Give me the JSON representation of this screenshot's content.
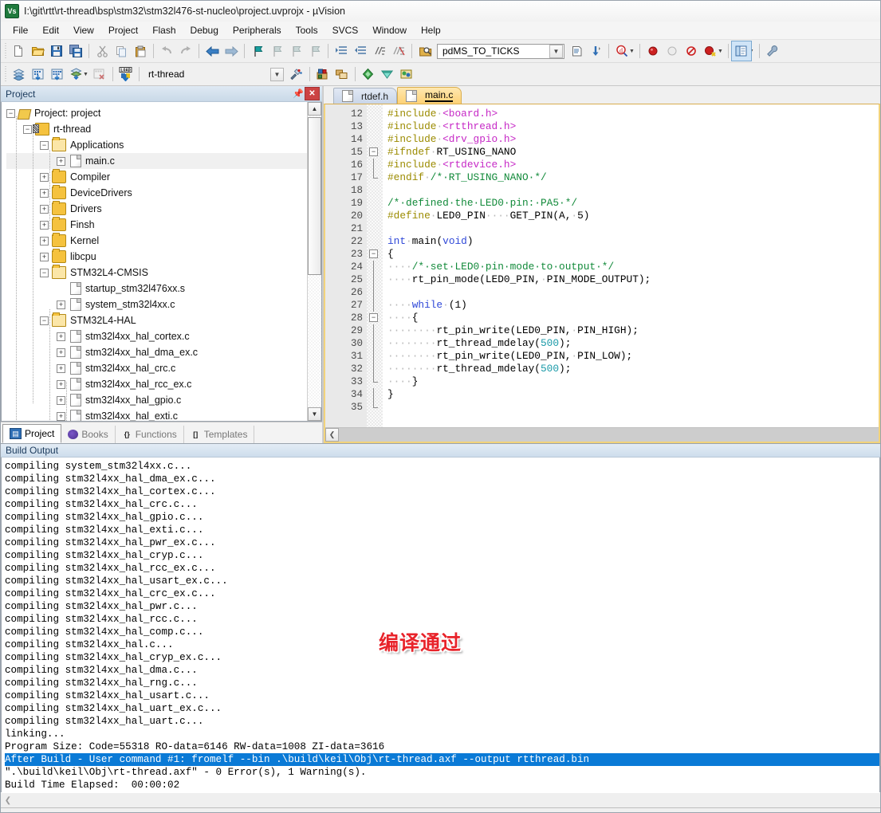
{
  "window": {
    "title": "I:\\git\\rtt\\rt-thread\\bsp\\stm32\\stm32l476-st-nucleo\\project.uvprojx - µVision",
    "app_badge": "Vs"
  },
  "menubar": {
    "items": [
      "File",
      "Edit",
      "View",
      "Project",
      "Flash",
      "Debug",
      "Peripherals",
      "Tools",
      "SVCS",
      "Window",
      "Help"
    ]
  },
  "toolbar1": {
    "groups": [
      [
        "new-file-icon",
        "open-file-icon",
        "save-icon",
        "save-all-icon"
      ],
      [
        "cut-icon",
        "copy-icon",
        "paste-icon"
      ],
      [
        "undo-icon",
        "redo-icon"
      ],
      [
        "navigate-back-icon",
        "navigate-forward-icon"
      ],
      [
        "bookmark-toggle-icon",
        "bookmark-prev-icon",
        "bookmark-next-icon",
        "bookmark-clear-icon"
      ],
      [
        "indent-icon",
        "outdent-icon",
        "comment-icon",
        "uncomment-icon"
      ]
    ],
    "find_in_files_icon": "find-in-files-icon",
    "find_value": "pdMS_TO_TICKS",
    "bookmark_list_icon": "text-list-icon",
    "goto_icon": "goto-icon",
    "debug_query_icon": "debug-query-icon",
    "breakpoint_icon": "insert-breakpoint-icon",
    "breakpoint_disable_icon": "disable-breakpoint-icon",
    "breakpoint_kill_icon": "kill-all-breakpoints-icon",
    "breakpoint_enable_icon": "enable-breakpoint-icon",
    "window_layout_icon": "window-layout-icon",
    "configure_icon": "configure-target-icon"
  },
  "toolbar2": {
    "translate_icon": "translate-icon",
    "build_icon": "build-icon",
    "rebuild_icon": "rebuild-all-icon",
    "batch_build_icon": "batch-build-icon",
    "stop_build_icon": "stop-build-icon",
    "download_icon": "load-download-icon",
    "target_value": "rt-thread",
    "target_options_icon": "target-options-icon",
    "manage_project_icon": "manage-project-items-icon",
    "multi_project_icon": "multi-project-icon",
    "pack_installer_icon": "pack-installer-icon",
    "manage_runtime_icon": "manage-runtime-environment-icon",
    "select_software_icon": "select-software-packs-icon"
  },
  "project_panel": {
    "caption": "Project",
    "pin_icon": "pin-icon",
    "close_icon": "close-icon",
    "tree": [
      {
        "indent": 0,
        "expander": "minus",
        "icon": "project-icon",
        "label": "Project: project",
        "selected": false
      },
      {
        "indent": 1,
        "expander": "minus",
        "icon": "target-icon",
        "label": "rt-thread",
        "selected": false
      },
      {
        "indent": 2,
        "expander": "minus",
        "icon": "folder-open-icon",
        "label": "Applications",
        "selected": false
      },
      {
        "indent": 3,
        "expander": "plus",
        "icon": "file-icon",
        "label": "main.c",
        "selected": true
      },
      {
        "indent": 2,
        "expander": "plus",
        "icon": "folder-icon",
        "label": "Compiler",
        "selected": false
      },
      {
        "indent": 2,
        "expander": "plus",
        "icon": "folder-icon",
        "label": "DeviceDrivers",
        "selected": false
      },
      {
        "indent": 2,
        "expander": "plus",
        "icon": "folder-icon",
        "label": "Drivers",
        "selected": false
      },
      {
        "indent": 2,
        "expander": "plus",
        "icon": "folder-icon",
        "label": "Finsh",
        "selected": false
      },
      {
        "indent": 2,
        "expander": "plus",
        "icon": "folder-icon",
        "label": "Kernel",
        "selected": false
      },
      {
        "indent": 2,
        "expander": "plus",
        "icon": "folder-icon",
        "label": "libcpu",
        "selected": false
      },
      {
        "indent": 2,
        "expander": "minus",
        "icon": "folder-open-icon",
        "label": "STM32L4-CMSIS",
        "selected": false
      },
      {
        "indent": 3,
        "expander": "none",
        "icon": "file-icon",
        "label": "startup_stm32l476xx.s",
        "selected": false
      },
      {
        "indent": 3,
        "expander": "plus",
        "icon": "file-icon",
        "label": "system_stm32l4xx.c",
        "selected": false
      },
      {
        "indent": 2,
        "expander": "minus",
        "icon": "folder-open-icon",
        "label": "STM32L4-HAL",
        "selected": false
      },
      {
        "indent": 3,
        "expander": "plus",
        "icon": "file-icon",
        "label": "stm32l4xx_hal_cortex.c",
        "selected": false
      },
      {
        "indent": 3,
        "expander": "plus",
        "icon": "file-icon",
        "label": "stm32l4xx_hal_dma_ex.c",
        "selected": false
      },
      {
        "indent": 3,
        "expander": "plus",
        "icon": "file-icon",
        "label": "stm32l4xx_hal_crc.c",
        "selected": false
      },
      {
        "indent": 3,
        "expander": "plus",
        "icon": "file-icon",
        "label": "stm32l4xx_hal_rcc_ex.c",
        "selected": false
      },
      {
        "indent": 3,
        "expander": "plus",
        "icon": "file-icon",
        "label": "stm32l4xx_hal_gpio.c",
        "selected": false
      },
      {
        "indent": 3,
        "expander": "plus",
        "icon": "file-icon",
        "label": "stm32l4xx_hal_exti.c",
        "selected": false
      }
    ],
    "tabs": [
      {
        "label": "Project",
        "icon": "project-tab-icon",
        "active": true
      },
      {
        "label": "Books",
        "icon": "books-tab-icon",
        "active": false
      },
      {
        "label": "Functions",
        "icon": "functions-tab-icon",
        "active": false
      },
      {
        "label": "Templates",
        "icon": "templates-tab-icon",
        "active": false
      }
    ]
  },
  "editor": {
    "tabs": [
      {
        "label": "rtdef.h",
        "active": false,
        "icon": "file-icon"
      },
      {
        "label": "main.c",
        "active": true,
        "icon": "file-icon"
      }
    ],
    "first_line": 12,
    "lines": [
      {
        "n": 12,
        "fold": "none",
        "tokens": [
          {
            "t": "#include",
            "c": "pre"
          },
          {
            "t": "·",
            "c": "ws"
          },
          {
            "t": "<board.h>",
            "c": "inc"
          }
        ]
      },
      {
        "n": 13,
        "fold": "none",
        "tokens": [
          {
            "t": "#include",
            "c": "pre"
          },
          {
            "t": "·",
            "c": "ws"
          },
          {
            "t": "<rtthread.h>",
            "c": "inc"
          }
        ]
      },
      {
        "n": 14,
        "fold": "none",
        "tokens": [
          {
            "t": "#include",
            "c": "pre"
          },
          {
            "t": "·",
            "c": "ws"
          },
          {
            "t": "<drv_gpio.h>",
            "c": "inc"
          }
        ]
      },
      {
        "n": 15,
        "fold": "minus",
        "tokens": [
          {
            "t": "#ifndef",
            "c": "pre"
          },
          {
            "t": "·",
            "c": "ws"
          },
          {
            "t": "RT_USING_NANO",
            "c": "txt"
          }
        ]
      },
      {
        "n": 16,
        "fold": "bar",
        "tokens": [
          {
            "t": "#include",
            "c": "pre"
          },
          {
            "t": "·",
            "c": "ws"
          },
          {
            "t": "<rtdevice.h>",
            "c": "inc"
          }
        ]
      },
      {
        "n": 17,
        "fold": "barend",
        "tokens": [
          {
            "t": "#endif",
            "c": "pre"
          },
          {
            "t": "·",
            "c": "ws"
          },
          {
            "t": "/*·RT_USING_NANO·*/",
            "c": "cmt"
          }
        ]
      },
      {
        "n": 18,
        "fold": "none",
        "tokens": []
      },
      {
        "n": 19,
        "fold": "none",
        "tokens": [
          {
            "t": "/*·defined·the·LED0·pin:·PA5·*/",
            "c": "cmt"
          }
        ]
      },
      {
        "n": 20,
        "fold": "none",
        "tokens": [
          {
            "t": "#define",
            "c": "pre"
          },
          {
            "t": "·",
            "c": "ws"
          },
          {
            "t": "LED0_PIN",
            "c": "txt"
          },
          {
            "t": "····",
            "c": "ws"
          },
          {
            "t": "GET_PIN(A,",
            "c": "txt"
          },
          {
            "t": "·",
            "c": "ws"
          },
          {
            "t": "5)",
            "c": "txt"
          }
        ]
      },
      {
        "n": 21,
        "fold": "none",
        "tokens": []
      },
      {
        "n": 22,
        "fold": "none",
        "tokens": [
          {
            "t": "int",
            "c": "key"
          },
          {
            "t": "·",
            "c": "ws"
          },
          {
            "t": "main(",
            "c": "txt"
          },
          {
            "t": "void",
            "c": "key"
          },
          {
            "t": ")",
            "c": "txt"
          }
        ]
      },
      {
        "n": 23,
        "fold": "minus",
        "tokens": [
          {
            "t": "{",
            "c": "txt"
          }
        ]
      },
      {
        "n": 24,
        "fold": "bar",
        "tokens": [
          {
            "t": "····",
            "c": "ws"
          },
          {
            "t": "/*·set·LED0·pin·mode·to·output·*/",
            "c": "cmt"
          }
        ]
      },
      {
        "n": 25,
        "fold": "bar",
        "tokens": [
          {
            "t": "····",
            "c": "ws"
          },
          {
            "t": "rt_pin_mode(LED0_PIN,",
            "c": "txt"
          },
          {
            "t": "·",
            "c": "ws"
          },
          {
            "t": "PIN_MODE_OUTPUT);",
            "c": "txt"
          }
        ]
      },
      {
        "n": 26,
        "fold": "bar",
        "tokens": []
      },
      {
        "n": 27,
        "fold": "bar",
        "tokens": [
          {
            "t": "····",
            "c": "ws"
          },
          {
            "t": "while",
            "c": "key"
          },
          {
            "t": "·",
            "c": "ws"
          },
          {
            "t": "(1)",
            "c": "txt"
          }
        ]
      },
      {
        "n": 28,
        "fold": "minus2",
        "tokens": [
          {
            "t": "····",
            "c": "ws"
          },
          {
            "t": "{",
            "c": "txt"
          }
        ]
      },
      {
        "n": 29,
        "fold": "bar",
        "tokens": [
          {
            "t": "········",
            "c": "ws"
          },
          {
            "t": "rt_pin_write(LED0_PIN,",
            "c": "txt"
          },
          {
            "t": "·",
            "c": "ws"
          },
          {
            "t": "PIN_HIGH);",
            "c": "txt"
          }
        ]
      },
      {
        "n": 30,
        "fold": "bar",
        "tokens": [
          {
            "t": "········",
            "c": "ws"
          },
          {
            "t": "rt_thread_mdelay(",
            "c": "txt"
          },
          {
            "t": "500",
            "c": "num"
          },
          {
            "t": ");",
            "c": "txt"
          }
        ]
      },
      {
        "n": 31,
        "fold": "bar",
        "tokens": [
          {
            "t": "········",
            "c": "ws"
          },
          {
            "t": "rt_pin_write(LED0_PIN,",
            "c": "txt"
          },
          {
            "t": "·",
            "c": "ws"
          },
          {
            "t": "PIN_LOW);",
            "c": "txt"
          }
        ]
      },
      {
        "n": 32,
        "fold": "bar",
        "tokens": [
          {
            "t": "········",
            "c": "ws"
          },
          {
            "t": "rt_thread_mdelay(",
            "c": "txt"
          },
          {
            "t": "500",
            "c": "num"
          },
          {
            "t": ");",
            "c": "txt"
          }
        ]
      },
      {
        "n": 33,
        "fold": "barend",
        "tokens": [
          {
            "t": "····",
            "c": "ws"
          },
          {
            "t": "}",
            "c": "txt"
          }
        ]
      },
      {
        "n": 34,
        "fold": "bar",
        "tokens": [
          {
            "t": "}",
            "c": "txt"
          }
        ]
      },
      {
        "n": 35,
        "fold": "barend",
        "tokens": []
      }
    ]
  },
  "build_output": {
    "caption": "Build Output",
    "lines": [
      {
        "text": "compiling system_stm32l4xx.c...",
        "highlight": false
      },
      {
        "text": "compiling stm32l4xx_hal_dma_ex.c...",
        "highlight": false
      },
      {
        "text": "compiling stm32l4xx_hal_cortex.c...",
        "highlight": false
      },
      {
        "text": "compiling stm32l4xx_hal_crc.c...",
        "highlight": false
      },
      {
        "text": "compiling stm32l4xx_hal_gpio.c...",
        "highlight": false
      },
      {
        "text": "compiling stm32l4xx_hal_exti.c...",
        "highlight": false
      },
      {
        "text": "compiling stm32l4xx_hal_pwr_ex.c...",
        "highlight": false
      },
      {
        "text": "compiling stm32l4xx_hal_cryp.c...",
        "highlight": false
      },
      {
        "text": "compiling stm32l4xx_hal_rcc_ex.c...",
        "highlight": false
      },
      {
        "text": "compiling stm32l4xx_hal_usart_ex.c...",
        "highlight": false
      },
      {
        "text": "compiling stm32l4xx_hal_crc_ex.c...",
        "highlight": false
      },
      {
        "text": "compiling stm32l4xx_hal_pwr.c...",
        "highlight": false
      },
      {
        "text": "compiling stm32l4xx_hal_rcc.c...",
        "highlight": false
      },
      {
        "text": "compiling stm32l4xx_hal_comp.c...",
        "highlight": false
      },
      {
        "text": "compiling stm32l4xx_hal.c...",
        "highlight": false
      },
      {
        "text": "compiling stm32l4xx_hal_cryp_ex.c...",
        "highlight": false
      },
      {
        "text": "compiling stm32l4xx_hal_dma.c...",
        "highlight": false
      },
      {
        "text": "compiling stm32l4xx_hal_rng.c...",
        "highlight": false
      },
      {
        "text": "compiling stm32l4xx_hal_usart.c...",
        "highlight": false
      },
      {
        "text": "compiling stm32l4xx_hal_uart_ex.c...",
        "highlight": false
      },
      {
        "text": "compiling stm32l4xx_hal_uart.c...",
        "highlight": false
      },
      {
        "text": "linking...",
        "highlight": false
      },
      {
        "text": "Program Size: Code=55318 RO-data=6146 RW-data=1008 ZI-data=3616",
        "highlight": false
      },
      {
        "text": "After Build - User command #1: fromelf --bin .\\build\\keil\\Obj\\rt-thread.axf --output rtthread.bin",
        "highlight": true
      },
      {
        "text": "\".\\build\\keil\\Obj\\rt-thread.axf\" - 0 Error(s), 1 Warning(s).",
        "highlight": false
      },
      {
        "text": "Build Time Elapsed:  00:00:02",
        "highlight": false
      }
    ],
    "watermark": "编译通过",
    "scroll_left_icon": "scroll-left-icon"
  },
  "colors": {
    "highlight_bg": "#0a7ad6",
    "watermark": "#e8232a",
    "preprocessor": "#9b8b00",
    "include": "#c628c6",
    "comment": "#128a3a",
    "keyword": "#2f48d8",
    "number": "#1a9aa8"
  }
}
